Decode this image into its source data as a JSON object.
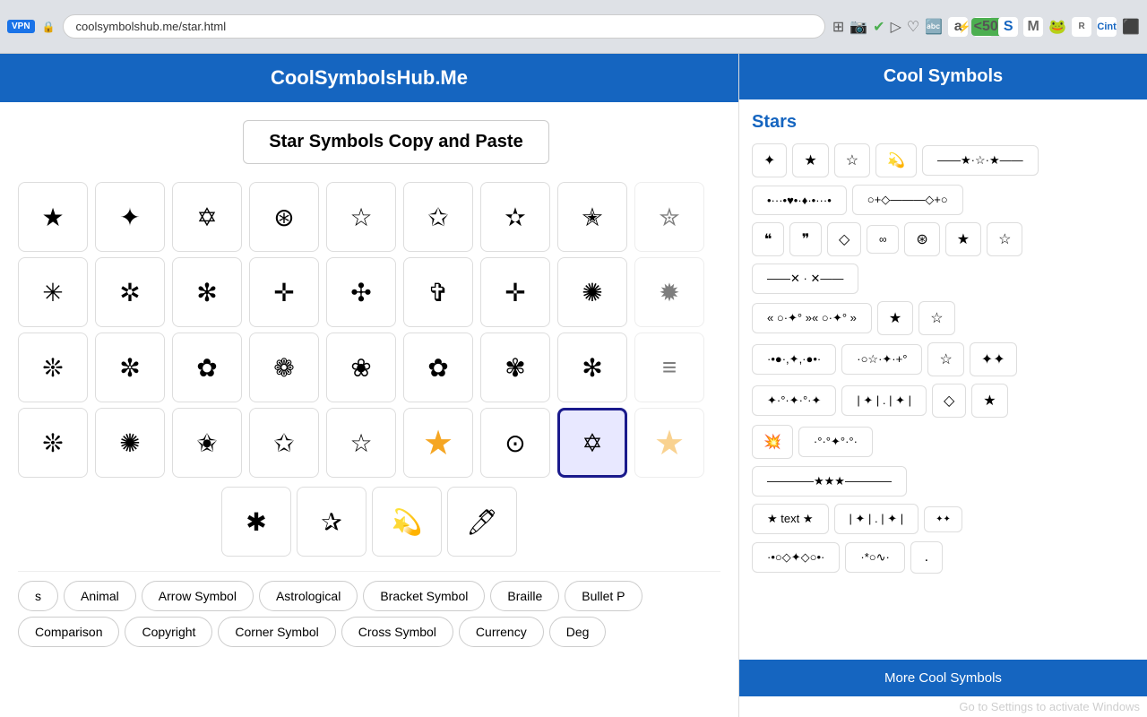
{
  "browser": {
    "url": "coolsymbolshub.me/star.html",
    "vpn_label": "VPN"
  },
  "site": {
    "title": "CoolSymbolsHub.Me",
    "page_title": "Star Symbols Copy and Paste"
  },
  "right_panel": {
    "title": "Cool Symbols",
    "section_title": "Stars",
    "footer_label": "More Cool Symbols"
  },
  "symbols_row1": [
    "★",
    "✦",
    "✡",
    "⊛",
    "☆",
    "✩",
    "✫",
    "✭"
  ],
  "symbols_row2": [
    "✳",
    "✲",
    "✻",
    "✛",
    "✣",
    "✞",
    "✛",
    "✺"
  ],
  "symbols_row3": [
    "❊",
    "✼",
    "✿",
    "❁",
    "❀",
    "✿",
    "✾",
    "✻"
  ],
  "symbols_row4": [
    "❊",
    "✺",
    "✬",
    "✩",
    "☆",
    "★",
    "⊙",
    "★"
  ],
  "bottom_symbols": [
    "✱",
    "✰",
    "💫",
    "🖊"
  ],
  "categories": [
    "Animal",
    "Arrow Symbol",
    "Astrological",
    "Bracket Symbol",
    "Braille",
    "Bullet P",
    "Comparison",
    "Copyright",
    "Corner Symbol",
    "Cross Symbol",
    "Currency",
    "Deg"
  ],
  "right_symbols": {
    "row1_singles": [
      "✦",
      "★",
      "☆",
      "💫"
    ],
    "row1_wide": "——★·☆·★——",
    "row2_wide1": "•···•♥•·♦·•···•",
    "row2_wide2": "○+◇——————◇+○",
    "row3_singles": [
      "❝",
      "❞",
      "◇",
      "∞",
      "⊛"
    ],
    "row3_star": "☆",
    "row4_wide": "——✕·   ·✕——",
    "row5": [
      "«",
      "○·✦°",
      "»«",
      "○·✦°",
      "»"
    ],
    "row5_singles": [
      "★",
      "☆"
    ],
    "row6_wide1": "·•●·,✦,·●•·",
    "row6_wide2": "·○☆·✦·+°",
    "row6_singles": [
      "☆",
      "✦✦"
    ],
    "row7_wide": "✦·°·✦·°·✦",
    "row7_multi": "| ✦ | . | ✦ |",
    "row7_single": "◇",
    "row7_star": "★",
    "row8_wide": "💥",
    "row8_scatter": "·°·°✦°·°·",
    "row9_wide1": "————★★★————",
    "row10_text": "★ text ★",
    "row11_wide1": "·•○◇ · ✦ · ◇○•·",
    "row11_singles2": "| ✦ | . | ✦ |",
    "row12_wide": "·•○◇✦◇○•·"
  }
}
